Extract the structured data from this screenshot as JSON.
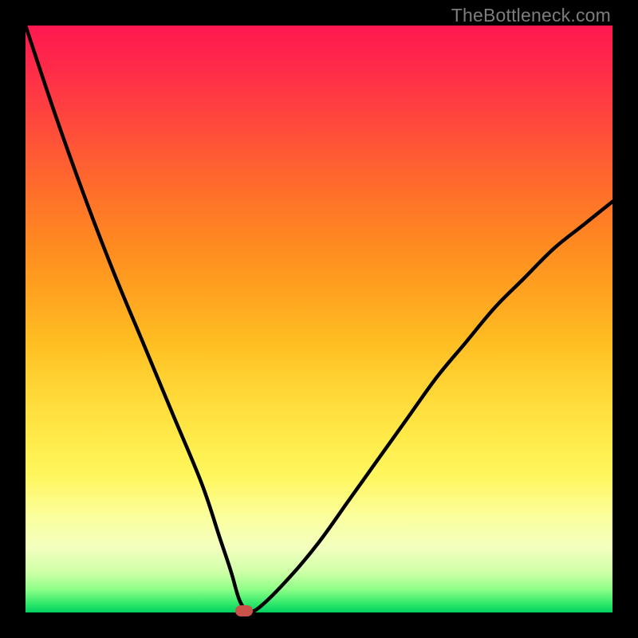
{
  "watermark": "TheBottleneck.com",
  "chart_data": {
    "type": "line",
    "title": "",
    "xlabel": "",
    "ylabel": "",
    "xlim": [
      0,
      100
    ],
    "ylim": [
      0,
      100
    ],
    "grid": false,
    "legend": false,
    "series": [
      {
        "name": "bottleneck-curve",
        "x": [
          0,
          5,
          10,
          15,
          20,
          25,
          30,
          33,
          35,
          36.5,
          38,
          40,
          45,
          50,
          55,
          60,
          65,
          70,
          75,
          80,
          85,
          90,
          95,
          100
        ],
        "y": [
          100,
          85,
          71,
          58,
          46,
          34,
          22,
          13,
          7,
          2,
          0.3,
          1,
          6,
          12,
          19,
          26,
          33,
          40,
          46,
          52,
          57,
          62,
          66,
          70
        ]
      }
    ],
    "marker": {
      "x": 37.2,
      "y": 0.3,
      "color": "#c9524b"
    }
  },
  "colors": {
    "background": "#000000",
    "gradient_top": "#ff1850",
    "gradient_bottom": "#00d060",
    "curve": "#000000",
    "marker": "#c9524b",
    "watermark": "#7d7d7d"
  }
}
